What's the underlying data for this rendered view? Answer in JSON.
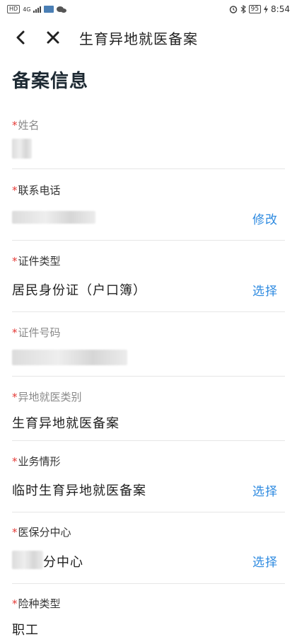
{
  "status_bar": {
    "network_chip": "HD",
    "network_type": "4G",
    "battery": "95",
    "time": "8:54"
  },
  "header": {
    "back_icon": "chevron-left-icon",
    "close_icon": "close-icon",
    "title": "生育异地就医备案"
  },
  "section": {
    "title": "备案信息"
  },
  "fields": [
    {
      "label": "姓名",
      "required": "*",
      "value": "",
      "action": ""
    },
    {
      "label": "联系电话",
      "required": "*",
      "value": "",
      "action": "修改"
    },
    {
      "label": "证件类型",
      "required": "*",
      "value": "居民身份证（户口簿）",
      "action": "选择"
    },
    {
      "label": "证件号码",
      "required": "*",
      "value": "",
      "action": ""
    },
    {
      "label": "异地就医类别",
      "required": "*",
      "value": "生育异地就医备案",
      "action": ""
    },
    {
      "label": "业务情形",
      "required": "*",
      "value": "临时生育异地就医备案",
      "action": "选择"
    },
    {
      "label": "医保分中心",
      "required": "*",
      "value": "分中心",
      "action": "选择"
    },
    {
      "label": "险种类型",
      "required": "*",
      "value": "职工",
      "action": ""
    }
  ],
  "colors": {
    "accent": "#2d8ae0",
    "required": "#e53935",
    "title": "#1e2a33"
  }
}
